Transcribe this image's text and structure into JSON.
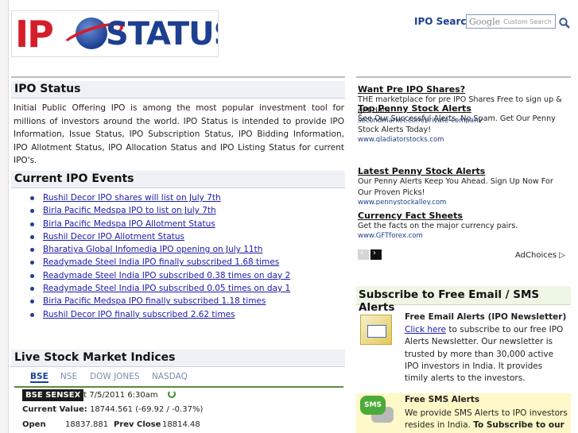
{
  "header": {
    "logo_text_ipo": "IP",
    "logo_text_status": "STATUS",
    "search_label": "IPO Search",
    "search_google": "Google",
    "search_placeholder": "Custom Search"
  },
  "ipo_status": {
    "heading": "IPO Status",
    "text": "Initial Public Offering IPO is among the most popular investment tool for millions of investors around the world. IPO Status is intended to provide IPO Information, Issue Status, IPO Subscription Status, IPO Bidding Information, IPO Allotment Status, IPO Allocation Status and IPO Listing Status for current IPO's."
  },
  "current_events": {
    "heading": "Current IPO Events",
    "items": [
      "Rushil Decor IPO shares will list on July 7th",
      "Birla Pacific Medspa IPO to list on July 7th",
      "Birla Pacific Medspa IPO Allotment Status",
      "Rushil Decor IPO Allotment Status",
      "Bharatiya Global Infomedia IPO opening on July 11th",
      "Readymade Steel India IPO finally subscribed 1.68 times",
      "Readymade Steel India IPO subscribed 0.38 times on day 2",
      "Readymade Steel India IPO subscribed 0.05 times on day 1",
      "Birla Pacific Medspa IPO finally subscribed 1.18 times",
      "Rushil Decor IPO finally subscribed 2.62 times"
    ]
  },
  "market": {
    "heading": "Live Stock Market Indices",
    "tabs": [
      "BSE",
      "NSE",
      "DOW JONES",
      "NASDAQ"
    ],
    "index_name": "BSE SENSEX",
    "timestamp": "at 7/5/2011 6:30am",
    "current_value_label": "Current Value:",
    "current_value": "18744.561 (-69.92 / -0.37%)",
    "open_label": "Open",
    "open_value": "18837.881",
    "prev_close_label": "Prev Close",
    "prev_close_value": "18814.48"
  },
  "ads": {
    "items": [
      {
        "title": "Want Pre IPO Shares?",
        "body": "THE marketplace for pre IPO Shares Free to sign up & get data",
        "url": "secondmarket.com/private-company"
      },
      {
        "title": "Top Penny Stock Alerts",
        "body": "See Our Successful Alerts. No Spam. Get Our Penny Stock Alerts Today!",
        "url": "www.gladiatorstocks.com"
      },
      {
        "title": "Latest Penny Stock Alerts",
        "body": "Our Penny Alerts Keep You Ahead. Sign Up Now For Our Proven Picks!",
        "url": "www.pennystockalley.com"
      },
      {
        "title": "Currency Fact Sheets",
        "body": "Get the facts on the major currency pairs.",
        "url": "www.GFTforex.com"
      }
    ],
    "adchoices": "AdChoices"
  },
  "subscribe": {
    "heading": "Subscribe to Free Email / SMS Alerts",
    "newsletter_title": "Free Email Alerts (IPO Newsletter)",
    "newsletter_link": "Click here",
    "newsletter_text": " to subscribe to our free IPO Alerts Newsletter. Our newsletter is trusted by more than 30,000 active IPO investors in India. It provides timily alerts to the investors.",
    "sms_title": "Free SMS Alerts",
    "sms_text": "We provide SMS Alerts to IPO investors resides in India. ",
    "sms_bold": "To Subscribe to our free",
    "sms_icon_label": "SMS"
  }
}
